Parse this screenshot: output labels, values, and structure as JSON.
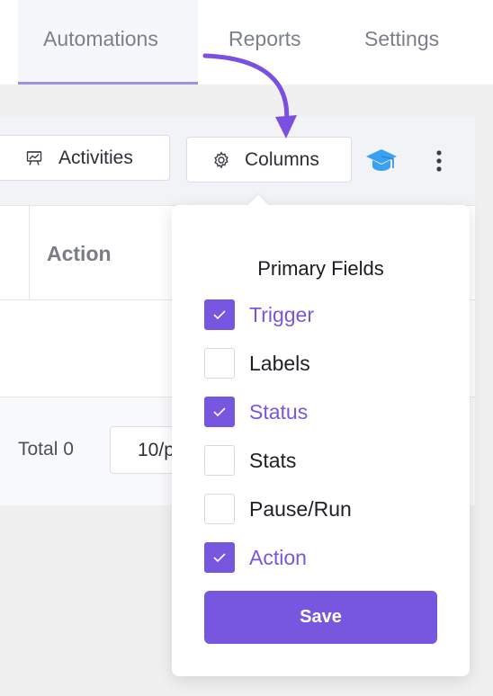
{
  "nav": {
    "tabs": [
      {
        "label": "Automations",
        "active": true
      },
      {
        "label": "Reports"
      },
      {
        "label": "Settings"
      }
    ]
  },
  "toolbar": {
    "activities_label": "Activities",
    "columns_label": "Columns"
  },
  "table": {
    "action_header": "Action"
  },
  "footer": {
    "total_label": "Total 0",
    "page_size": "10/p"
  },
  "columns_popover": {
    "title": "Primary Fields",
    "options": [
      {
        "label": "Trigger",
        "checked": true
      },
      {
        "label": "Labels",
        "checked": false
      },
      {
        "label": "Status",
        "checked": true
      },
      {
        "label": "Stats",
        "checked": false
      },
      {
        "label": "Pause/Run",
        "checked": false
      },
      {
        "label": "Action",
        "checked": true
      }
    ],
    "save_label": "Save"
  },
  "colors": {
    "accent": "#7857e0",
    "arrow": "#7b4fe0",
    "help_icon": "#3aa0f0"
  }
}
